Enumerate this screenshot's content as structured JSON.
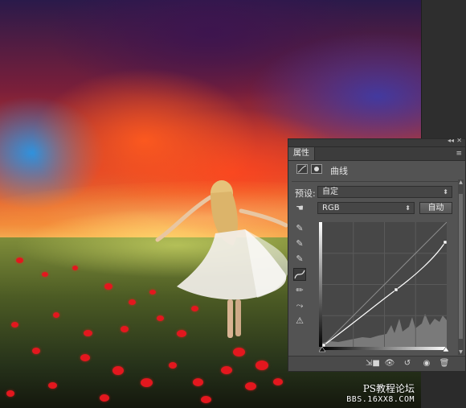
{
  "panel": {
    "tab_title": "属性",
    "adjustment_title": "曲线",
    "preset_label": "预设:",
    "preset_value": "自定",
    "channel_value": "RGB",
    "auto_button": "自动"
  },
  "watermark": {
    "line1": "PS教程论坛",
    "line2": "BBS.16XX8.COM"
  },
  "colors": {
    "panel_bg": "#535353",
    "graph_bg": "#474747",
    "poppy_red": "#e3171e"
  },
  "icons": {
    "curves": "curves-adjustment-icon",
    "mask": "layer-mask-icon",
    "hand": "on-image-adjust-hand-icon",
    "eyedropper_black": "eyedropper-black-icon",
    "eyedropper_gray": "eyedropper-gray-icon",
    "eyedropper_white": "eyedropper-white-icon",
    "curve_tool": "edit-points-curve-icon",
    "pencil": "pencil-draw-icon",
    "smooth": "smooth-curve-icon",
    "clipping": "clipping-warning-icon"
  }
}
